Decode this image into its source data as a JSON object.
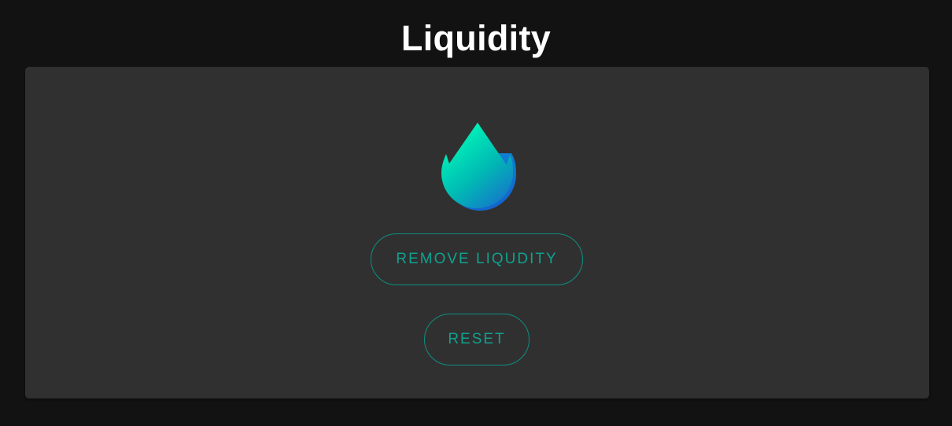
{
  "page": {
    "title": "Liquidity"
  },
  "card": {
    "icon": "liquidity-drop-icon",
    "remove_button_label": "REMOVE LIQUDITY",
    "reset_button_label": "RESET"
  },
  "colors": {
    "background": "#121212",
    "card": "#303030",
    "accent": "#11a08f",
    "drop_gradient_top": "#00f5b8",
    "drop_gradient_bottom": "#1466cc"
  }
}
